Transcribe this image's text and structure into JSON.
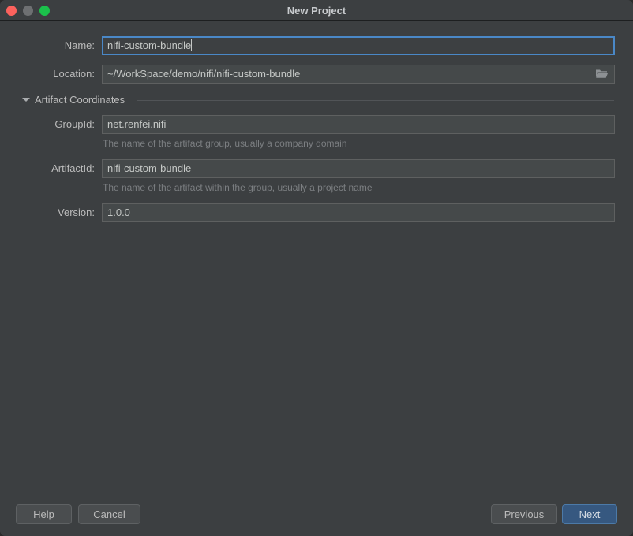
{
  "window": {
    "title": "New Project",
    "controls": [
      {
        "name": "close",
        "color": "#fc625d"
      },
      {
        "name": "minimize",
        "color": "#6e7072"
      },
      {
        "name": "zoom",
        "color": "#1bc14b"
      }
    ]
  },
  "form": {
    "name": {
      "label": "Name:",
      "value": "nifi-custom-bundle",
      "focused": true
    },
    "location": {
      "label": "Location:",
      "value": "~/WorkSpace/demo/nifi/nifi-custom-bundle",
      "browse_icon": "folder-icon"
    },
    "section": {
      "title": "Artifact Coordinates",
      "expanded": true,
      "toggle_icon": "chevron-down-icon"
    },
    "group_id": {
      "label": "GroupId:",
      "value": "net.renfei.nifi",
      "hint": "The name of the artifact group, usually a company domain"
    },
    "artifact_id": {
      "label": "ArtifactId:",
      "value": "nifi-custom-bundle",
      "hint": "The name of the artifact within the group, usually a project name"
    },
    "version": {
      "label": "Version:",
      "value": "1.0.0"
    }
  },
  "footer": {
    "help": "Help",
    "cancel": "Cancel",
    "previous": "Previous",
    "next": "Next"
  },
  "colors": {
    "dialog_bg": "#3c3f41",
    "field_bg": "#45494a",
    "accent": "#365880",
    "focus_border": "#4a88c7",
    "text": "#bbbbbb",
    "hint_text": "#7c7f82"
  }
}
